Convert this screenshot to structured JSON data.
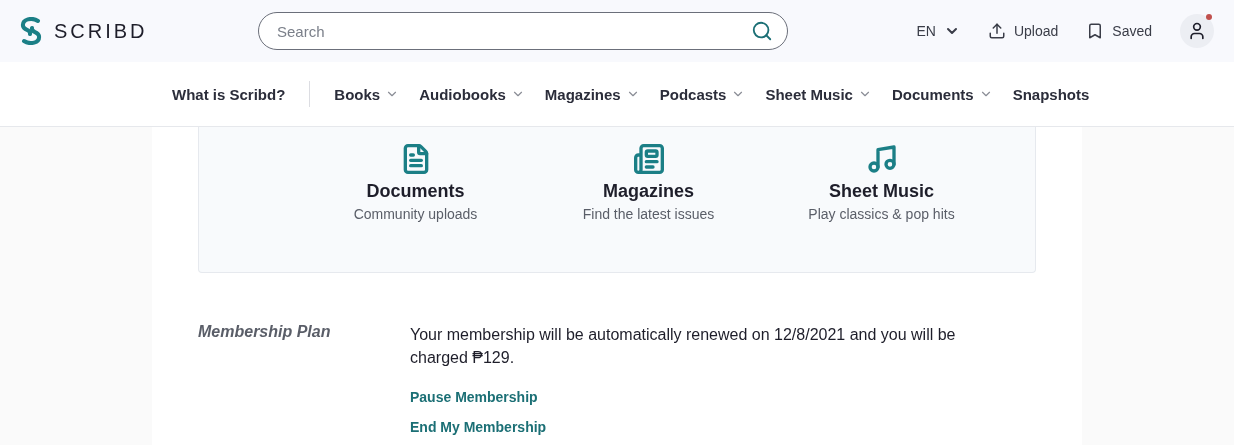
{
  "header": {
    "logo": "SCRIBD",
    "search": {
      "placeholder": "Search"
    },
    "language": "EN",
    "upload": "Upload",
    "saved": "Saved",
    "notification": true
  },
  "nav": [
    {
      "label": "What is Scribd?",
      "dropdown": false,
      "divider_after": true
    },
    {
      "label": "Books",
      "dropdown": true,
      "divider_after": false
    },
    {
      "label": "Audiobooks",
      "dropdown": true,
      "divider_after": false
    },
    {
      "label": "Magazines",
      "dropdown": true,
      "divider_after": false
    },
    {
      "label": "Podcasts",
      "dropdown": true,
      "divider_after": false
    },
    {
      "label": "Sheet Music",
      "dropdown": true,
      "divider_after": false
    },
    {
      "label": "Documents",
      "dropdown": true,
      "divider_after": false
    },
    {
      "label": "Snapshots",
      "dropdown": false,
      "divider_after": false
    }
  ],
  "categories": [
    {
      "kind": "document",
      "title": "Documents",
      "subtitle": "Community uploads"
    },
    {
      "kind": "magazine",
      "title": "Magazines",
      "subtitle": "Find the latest issues"
    },
    {
      "kind": "music",
      "title": "Sheet Music",
      "subtitle": "Play classics & pop hits"
    }
  ],
  "membership": {
    "label": "Membership Plan",
    "text": "Your membership will be automatically renewed on 12/8/2021 and you will be charged ₱129.",
    "links": [
      "Pause Membership",
      "End My Membership"
    ]
  }
}
